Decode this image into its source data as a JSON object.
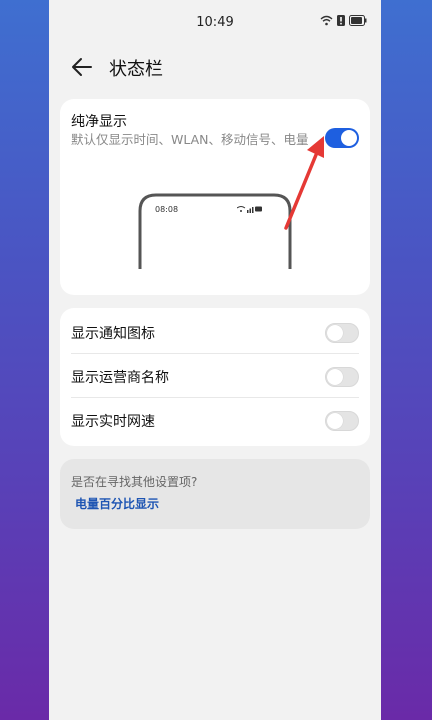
{
  "status_bar": {
    "time": "10:49"
  },
  "header": {
    "title": "状态栏"
  },
  "pure_display": {
    "title": "纯净显示",
    "description": "默认仅显示时间、WLAN、移动信号、电量",
    "enabled": true,
    "preview_time": "08:08"
  },
  "settings": [
    {
      "label": "显示通知图标",
      "enabled": false
    },
    {
      "label": "显示运营商名称",
      "enabled": false
    },
    {
      "label": "显示实时网速",
      "enabled": false
    }
  ],
  "hint": {
    "question": "是否在寻找其他设置项?",
    "link": "电量百分比显示"
  },
  "colors": {
    "accent": "#1e5fe0",
    "annotation_arrow": "#e53935"
  }
}
